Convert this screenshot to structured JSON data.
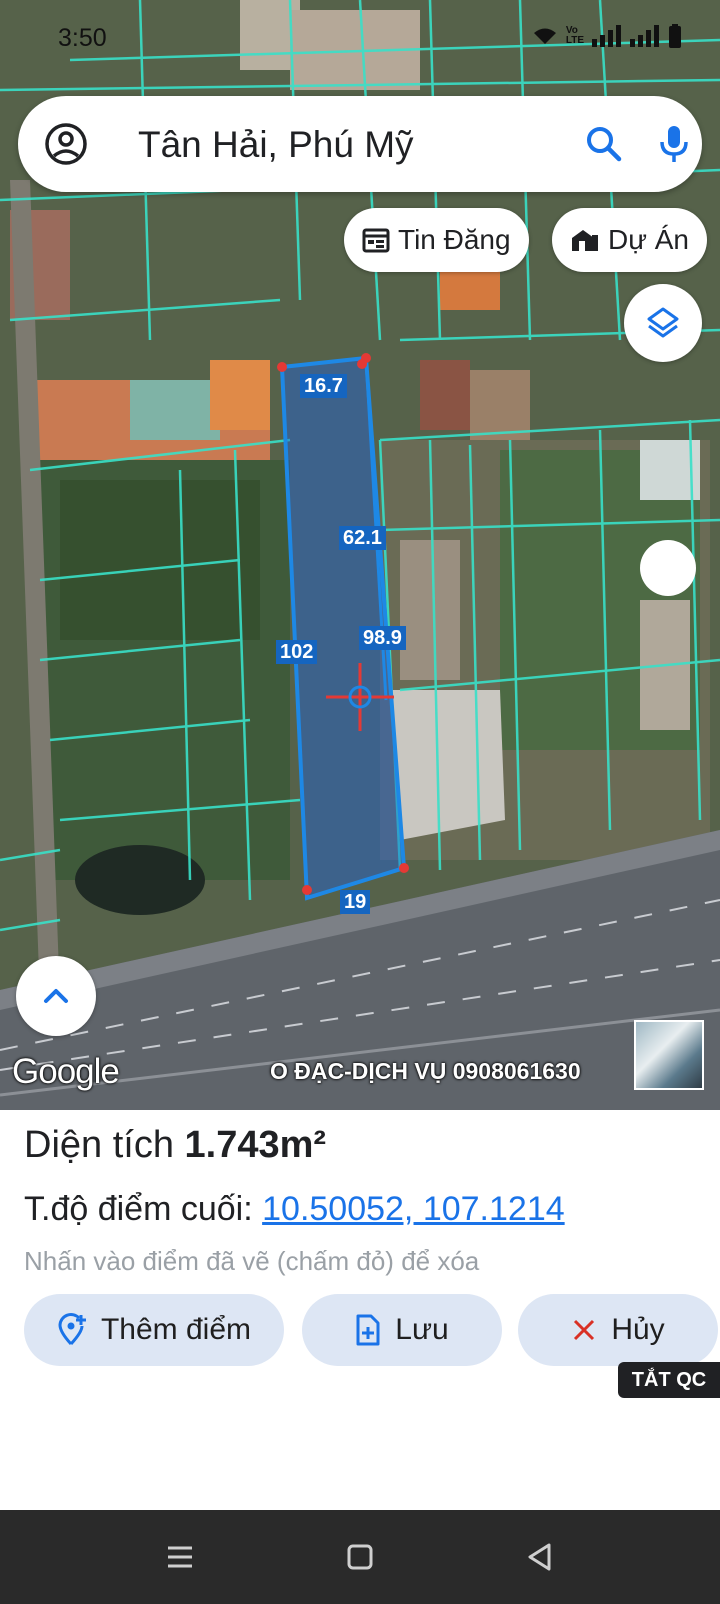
{
  "status": {
    "time": "3:50",
    "volte": "Vo\nLTE"
  },
  "search": {
    "query": "Tân Hải, Phú Mỹ"
  },
  "chips": {
    "tin_dang": "Tin Đăng",
    "du_an": "Dự Án"
  },
  "parcel": {
    "edges": {
      "top": "16.7",
      "inner_top": "62.1",
      "left": "102",
      "right": "98.9",
      "bottom": "19"
    }
  },
  "map_footer": {
    "google": "Google",
    "watermark": "O ĐẠC-DỊCH VỤ 0908061630"
  },
  "sheet": {
    "area_label": "Diện tích",
    "area_value": "1.743m²",
    "coord_label": "T.độ điểm cuối:",
    "coord_value": "10.50052, 107.1214",
    "hint": "Nhấn vào điểm đã vẽ (chấm đỏ) để xóa",
    "add_point": "Thêm điểm",
    "save": "Lưu",
    "cancel": "Hủy"
  },
  "ads_off": "TẮT QC",
  "colors": {
    "accent": "#1a73e8",
    "parcel_line": "#1e88e5",
    "cadastral": "#39e0c8",
    "vertex": "#e53935"
  },
  "icons": [
    "account-icon",
    "search-icon",
    "mic-icon",
    "listing-icon",
    "project-icon",
    "layers-icon",
    "chevron-up-icon",
    "add-location-icon",
    "save-file-icon",
    "close-icon",
    "menu-icon",
    "home-icon",
    "back-icon"
  ]
}
